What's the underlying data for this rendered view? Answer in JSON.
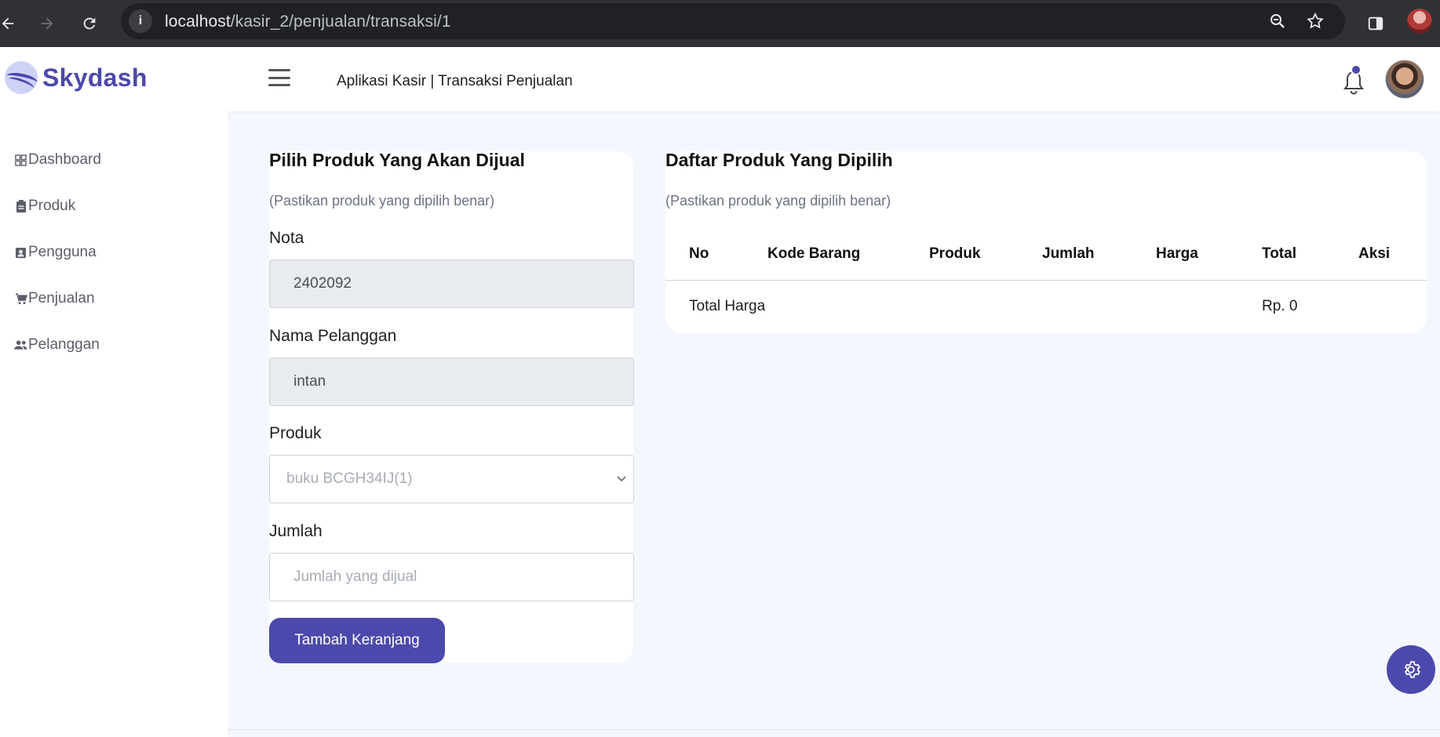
{
  "browser": {
    "url_host": "localhost",
    "url_path": "/kasir_2/penjualan/transaksi/1",
    "icons": [
      "back-icon",
      "forward-icon",
      "reload-icon",
      "site-info-icon",
      "zoom-icon",
      "bookmark-star-icon",
      "side-panel-icon",
      "profile-icon"
    ]
  },
  "header": {
    "brand": "Skydash",
    "title": "Aplikasi Kasir | Transaksi Penjualan",
    "icons": [
      "menu-icon",
      "bell-icon",
      "avatar"
    ]
  },
  "sidebar": {
    "items": [
      {
        "label": "Dashboard",
        "icon": "grid-icon"
      },
      {
        "label": "Produk",
        "icon": "clipboard-icon"
      },
      {
        "label": "Pengguna",
        "icon": "user-card-icon"
      },
      {
        "label": "Penjualan",
        "icon": "cart-icon"
      },
      {
        "label": "Pelanggan",
        "icon": "users-icon"
      }
    ]
  },
  "form": {
    "title": "Pilih Produk Yang Akan Dijual",
    "subtitle": "(Pastikan produk yang dipilih benar)",
    "nota_label": "Nota",
    "nota_value": "2402092",
    "pelanggan_label": "Nama Pelanggan",
    "pelanggan_value": "intan",
    "produk_label": "Produk",
    "produk_selected": "buku BCGH34IJ(1)",
    "jumlah_label": "Jumlah",
    "jumlah_placeholder": "Jumlah yang dijual",
    "submit_label": "Tambah Keranjang"
  },
  "cart": {
    "title": "Daftar Produk Yang Dipilih",
    "subtitle": "(Pastikan produk yang dipilih benar)",
    "columns": [
      "No",
      "Kode Barang",
      "Produk",
      "Jumlah",
      "Harga",
      "Total",
      "Aksi"
    ],
    "total_label": "Total Harga",
    "total_value": "Rp. 0"
  },
  "colors": {
    "accent": "#4b49ac",
    "background": "#f4f7fd"
  }
}
